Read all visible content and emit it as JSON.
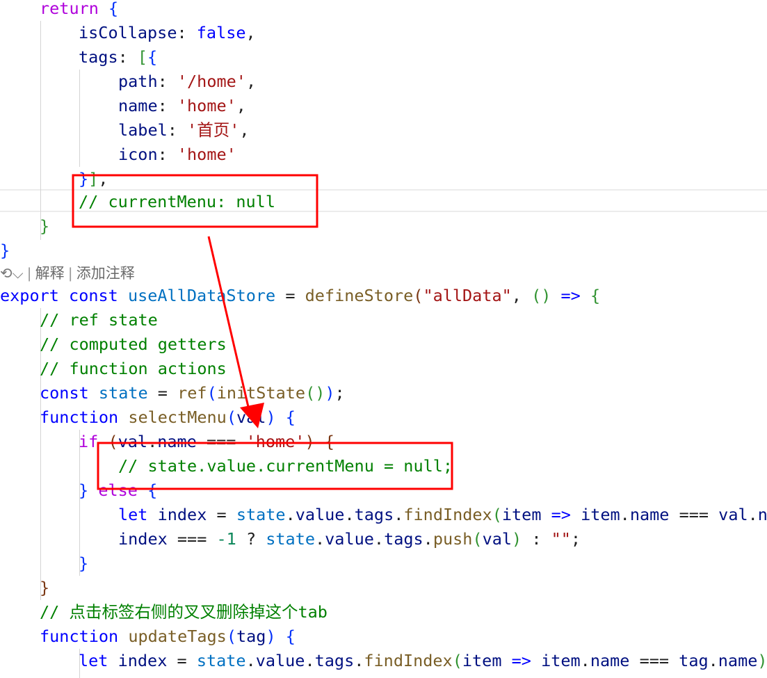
{
  "code": {
    "l1": {
      "kw": "return",
      "b": "{"
    },
    "l2": {
      "prop": "isCollapse",
      "colon": ": ",
      "val": "false",
      "end": ","
    },
    "l3": {
      "prop": "tags",
      "colon": ": ",
      "b1": "[",
      "b2": "{"
    },
    "l4": {
      "prop": "path",
      "colon": ": ",
      "val": "'/home'",
      "end": ","
    },
    "l5": {
      "prop": "name",
      "colon": ": ",
      "val": "'home'",
      "end": ","
    },
    "l6": {
      "prop": "label",
      "colon": ": ",
      "val": "'首页'",
      "end": ","
    },
    "l7": {
      "prop": "icon",
      "colon": ": ",
      "val": "'home'"
    },
    "l8": {
      "b1": "}",
      "b2": "]",
      "end": ","
    },
    "l9": {
      "comment": "// currentMenu: null"
    },
    "l10": {
      "b": "}"
    },
    "l11": {
      "b": "}"
    },
    "l12": {
      "export": "export",
      "const": "const",
      "name": "useAllDataStore",
      "eq": " = ",
      "fn": "defineStore",
      "p1": "(",
      "str": "\"allData\"",
      "comma": ", ",
      "p2": "()",
      "arrow": "=>",
      "b": "{"
    },
    "l13": {
      "comment": "// ref state"
    },
    "l14": {
      "comment": "// computed getters"
    },
    "l15": {
      "comment": "// function actions"
    },
    "l16": {
      "const": "const",
      "name": "state",
      "eq": " = ",
      "fn": "ref",
      "p1": "(",
      "fn2": "initState",
      "p2": "()",
      "p3": ")",
      "end": ";"
    },
    "l17": {
      "kw": "function",
      "fn": "selectMenu",
      "p1": "(",
      "param": "val",
      "p2": ")",
      "b": "{"
    },
    "l18": {
      "kw": "if",
      "p1": "(",
      "a": "val",
      "dot": ".",
      "b": "name",
      "op": " === ",
      "str": "'home'",
      "p2": ")",
      "brace": "{"
    },
    "l19": {
      "comment": "// state.value.currentMenu = null;"
    },
    "l20": {
      "b": "}",
      "kw": "else",
      "brace": "{"
    },
    "l21": {
      "kw": "let",
      "name": "index",
      "eq": " = ",
      "s": "state",
      "d1": ".",
      "v": "value",
      "d2": ".",
      "t": "tags",
      "d3": ".",
      "fn": "findIndex",
      "p1": "(",
      "it": "item",
      "arrow": "=>",
      "it2": "item",
      "d4": ".",
      "nm": "name",
      "op": " === ",
      "vl": "val",
      "d5": ".",
      "tail": "n"
    },
    "l22": {
      "name": "index",
      "op": " === ",
      "num": "-1",
      "q": " ? ",
      "s": "state",
      "d1": ".",
      "v": "value",
      "d2": ".",
      "t": "tags",
      "d3": ".",
      "fn": "push",
      "p1": "(",
      "arg": "val",
      "p2": ")",
      "colon": " : ",
      "str": "\"\"",
      "end": ";"
    },
    "l23": {
      "b": "}"
    },
    "l24": {
      "b": "}"
    },
    "l25": {
      "comment": "// 点击标签右侧的叉叉删除掉这个tab"
    },
    "l26": {
      "kw": "function",
      "fn": "updateTags",
      "p1": "(",
      "param": "tag",
      "p2": ")",
      "b": "{"
    },
    "l27": {
      "kw": "let",
      "name": "index",
      "eq": " = ",
      "s": "state",
      "d1": ".",
      "v": "value",
      "d2": ".",
      "t": "tags",
      "d3": ".",
      "fn": "findIndex",
      "p1": "(",
      "it": "item",
      "arrow": "=>",
      "it2": "item",
      "d4": ".",
      "nm": "name",
      "op": " === ",
      "tg": "tag",
      "d5": ".",
      "nm2": "name",
      "p2": ")"
    }
  },
  "codelens": {
    "icon": "⟲",
    "chevron": "⌵",
    "sep1": " | ",
    "explain": "解释",
    "sep2": " | ",
    "add_comment": "添加注释"
  },
  "annotation": {
    "color": "#ff0000"
  }
}
